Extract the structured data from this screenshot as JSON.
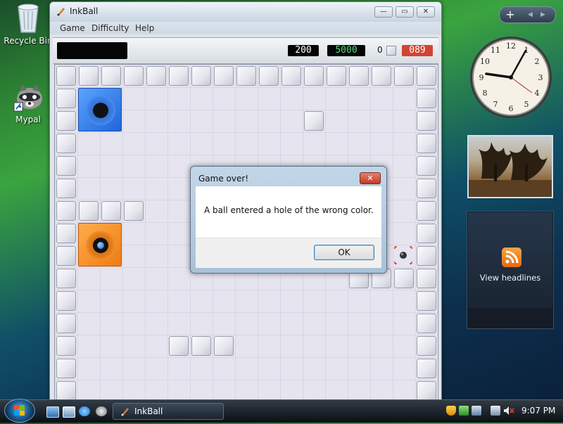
{
  "desktop": {
    "icons": [
      {
        "label": "Recycle Bin",
        "icon": "recycle-bin-icon"
      },
      {
        "label": "Mypal",
        "icon": "raccoon-icon"
      }
    ]
  },
  "sidebar": {
    "add_label": "+",
    "prev_label": "◀",
    "next_label": "▶",
    "clock": {
      "hour": 9,
      "minute": 7
    },
    "feed_label": "View headlines"
  },
  "window": {
    "title": "InkBall",
    "minimize": "—",
    "maximize": "▭",
    "close": "✕",
    "menu": [
      "Game",
      "Difficulty",
      "Help"
    ],
    "status": {
      "score1": "200",
      "score2": "5000",
      "count": "0",
      "timer": "089",
      "colors": {
        "score1": "#ffffff",
        "score2": "#56d77a",
        "timer_bg": "#d04434"
      }
    }
  },
  "dialog": {
    "title": "Game over!",
    "close_label": "✕",
    "message": "A ball entered a hole of the wrong color.",
    "ok_label": "OK"
  },
  "taskbar": {
    "task_label": "InkBall",
    "time": "9:07 PM"
  }
}
